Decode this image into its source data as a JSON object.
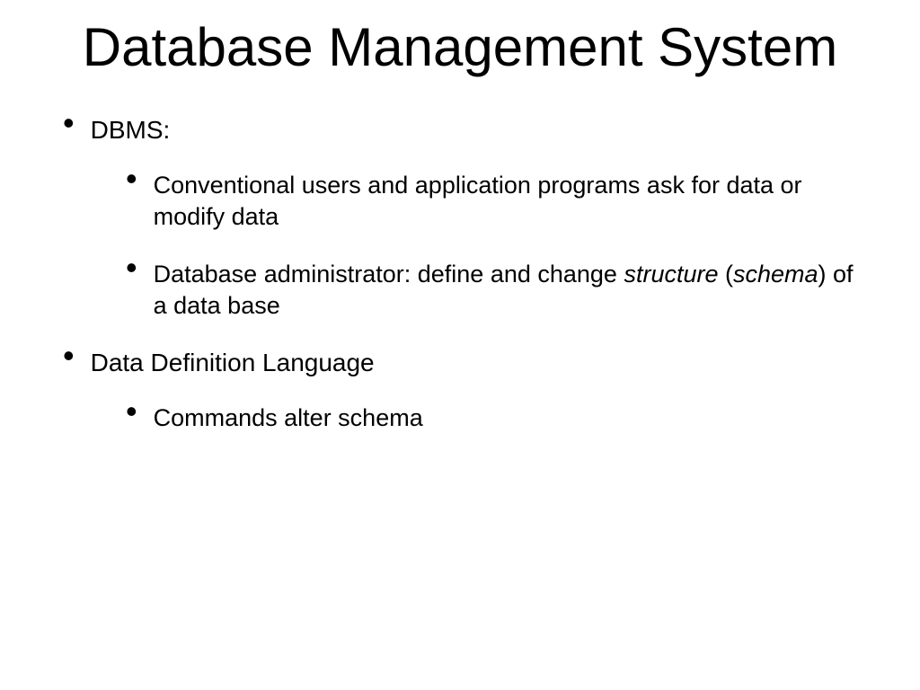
{
  "title": "Database Management System",
  "bullets": [
    {
      "text": "DBMS:",
      "children": [
        {
          "text": "Conventional users and application programs ask for data or modify data"
        },
        {
          "text_html": "Database administrator: define and change <span class=\"italic\">structure</span> (<span class=\"italic\">schema</span>) of a data base"
        }
      ]
    },
    {
      "text": "Data Definition Language",
      "children": [
        {
          "text": "Commands alter schema"
        }
      ]
    }
  ]
}
